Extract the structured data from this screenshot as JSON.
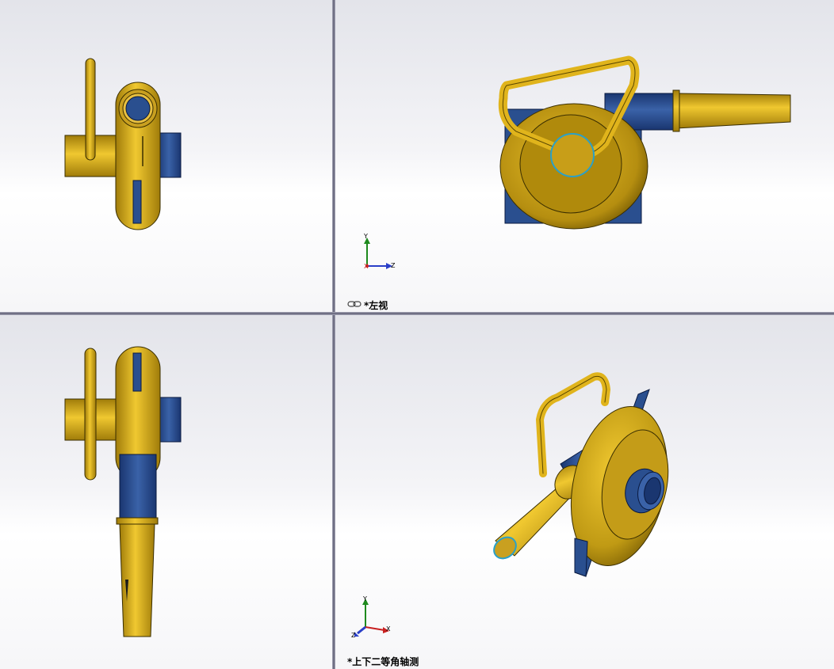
{
  "viewports": {
    "top_left": {
      "name": ""
    },
    "top_right": {
      "name": "*左视"
    },
    "bottom_left": {
      "name": ""
    },
    "bottom_right": {
      "name": "*上下二等角轴测"
    }
  },
  "triad": {
    "x_label": "X",
    "y_label": "Y",
    "z_label": "Z"
  },
  "colors": {
    "gold": "#e0b41c",
    "gold_dark": "#9a7808",
    "blue": "#2a4f8f",
    "blue_dark": "#17305e",
    "background_top": "#e3e4ea",
    "background_bottom": "#ffffff"
  },
  "icons": [
    "link-views-icon",
    "coordinate-triad-icon"
  ]
}
